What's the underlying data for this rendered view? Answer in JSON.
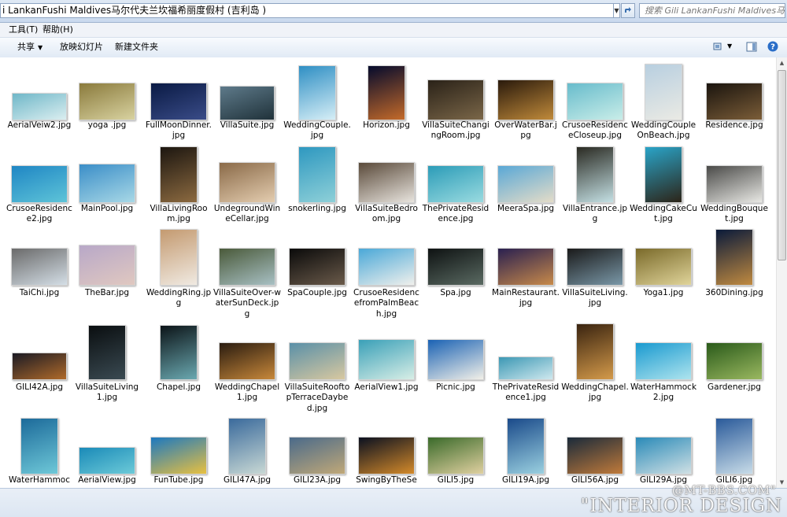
{
  "address_bar": {
    "path": "i LankanFushi Maldives马尔代夫兰坎福希丽度假村 (吉利岛 )",
    "search_placeholder": "搜索 Gili LankanFushi Maldives马..."
  },
  "menu": [
    "工具(T)",
    "帮助(H)"
  ],
  "toolbar": {
    "share": "共享",
    "slideshow": "放映幻灯片",
    "new_folder": "新建文件夹"
  },
  "files": [
    {
      "name": "AerialVeiw2.jpg",
      "c": [
        "#6fb7c8",
        "#dbeef0"
      ]
    },
    {
      "name": "yoga .jpg",
      "c": [
        "#8a7a3c",
        "#d8d2a0"
      ]
    },
    {
      "name": "FullMoonDinner.jpg",
      "c": [
        "#0a1a44",
        "#3a4c88"
      ]
    },
    {
      "name": "VillaSuite.jpg",
      "c": [
        "#5e7a8a",
        "#20323a"
      ]
    },
    {
      "name": "WeddingCouple.jpg",
      "c": [
        "#2f8fc4",
        "#d6eef6"
      ]
    },
    {
      "name": "Horizon.jpg",
      "c": [
        "#040a2c",
        "#c46a2a"
      ]
    },
    {
      "name": "VillaSuiteChangingRoom.jpg",
      "c": [
        "#2a2218",
        "#7a6648"
      ]
    },
    {
      "name": "OverWaterBar.jpg",
      "c": [
        "#2a1a0c",
        "#c08a3a"
      ]
    },
    {
      "name": "CrusoeResidenceCloseup.jpg",
      "c": [
        "#68bccc",
        "#c9ede8"
      ]
    },
    {
      "name": "WeddingCoupleOnBeach.jpg",
      "c": [
        "#b8cfe0",
        "#eaeae4"
      ]
    },
    {
      "name": "Residence.jpg",
      "c": [
        "#1a140e",
        "#7b5d38"
      ]
    },
    {
      "name": "CrusoeResidence2.jpg",
      "c": [
        "#1f86c4",
        "#5ec4d8"
      ]
    },
    {
      "name": "MainPool.jpg",
      "c": [
        "#3b8ec8",
        "#a8d8e6"
      ]
    },
    {
      "name": "VillaLivingRoom.jpg",
      "c": [
        "#1c1610",
        "#8c6a40"
      ]
    },
    {
      "name": "UndegroundWineCellar.jpg",
      "c": [
        "#8a6a48",
        "#e4cdb0"
      ]
    },
    {
      "name": "snokerling.jpg",
      "c": [
        "#2e98c0",
        "#8ed0d8"
      ]
    },
    {
      "name": "VillaSuiteBedroom.jpg",
      "c": [
        "#5a4a3a",
        "#e8e4de"
      ]
    },
    {
      "name": "ThePrivateResidence.jpg",
      "c": [
        "#2c9cb8",
        "#9adbe0"
      ]
    },
    {
      "name": "MeeraSpa.jpg",
      "c": [
        "#5aa8d6",
        "#e4dcc8"
      ]
    },
    {
      "name": "VillaEntrance.jpg",
      "c": [
        "#2a2a22",
        "#c4e0e4"
      ]
    },
    {
      "name": "WeddingCakeCut.jpg",
      "c": [
        "#2aa4c8",
        "#2c2418"
      ]
    },
    {
      "name": "WeddingBouquet.jpg",
      "c": [
        "#4a4a48",
        "#e8e8e4"
      ]
    },
    {
      "name": "TaiChi.jpg",
      "c": [
        "#6a6a6a",
        "#d4dee6"
      ]
    },
    {
      "name": "TheBar.jpg",
      "c": [
        "#b8a8c8",
        "#e0c8c0"
      ]
    },
    {
      "name": "WeddingRing.jpg",
      "c": [
        "#c49a70",
        "#f0eae2"
      ]
    },
    {
      "name": "VillaSuiteOver-waterSunDeck.jpg",
      "c": [
        "#4a5a3a",
        "#a8c0c4"
      ]
    },
    {
      "name": "SpaCouple.jpg",
      "c": [
        "#0a0a0a",
        "#6a5a4a"
      ]
    },
    {
      "name": "CrusoeResidencefromPalmBeach.jpg",
      "c": [
        "#4aa8d8",
        "#f0f0ec"
      ]
    },
    {
      "name": "Spa.jpg",
      "c": [
        "#0e1212",
        "#5a6a62"
      ]
    },
    {
      "name": "MainRestaurant.jpg",
      "c": [
        "#2a2050",
        "#c88a4a"
      ]
    },
    {
      "name": "VillaSuiteLiving.jpg",
      "c": [
        "#1a1a1a",
        "#7a98a8"
      ]
    },
    {
      "name": "Yoga1.jpg",
      "c": [
        "#7a6a2a",
        "#e0d49a"
      ]
    },
    {
      "name": "360Dining.jpg",
      "c": [
        "#0a1a3a",
        "#c08a40"
      ]
    },
    {
      "name": "GILI42A.jpg",
      "c": [
        "#1a1a24",
        "#b06a2a"
      ]
    },
    {
      "name": "VillaSuiteLiving1.jpg",
      "c": [
        "#0a0e10",
        "#3a4a52"
      ]
    },
    {
      "name": "Chapel.jpg",
      "c": [
        "#0c1418",
        "#6aa8b0"
      ]
    },
    {
      "name": "WeddingChapel1.jpg",
      "c": [
        "#2a1c10",
        "#c8883a"
      ]
    },
    {
      "name": "VillaSuiteRooftopTerraceDaybed.jpg",
      "c": [
        "#5a90a8",
        "#d8c8a0"
      ]
    },
    {
      "name": "AerialView1.jpg",
      "c": [
        "#3aa0b8",
        "#d8eee6"
      ]
    },
    {
      "name": "Picnic.jpg",
      "c": [
        "#1a62b4",
        "#f2f0e8"
      ]
    },
    {
      "name": "ThePrivateResidence1.jpg",
      "c": [
        "#3c98b4",
        "#cfe8ee"
      ]
    },
    {
      "name": "WeddingChapel.jpg",
      "c": [
        "#3a2410",
        "#d49a4a"
      ]
    },
    {
      "name": "WaterHammock2.jpg",
      "c": [
        "#1a9ad0",
        "#aee4ee"
      ]
    },
    {
      "name": "Gardener.jpg",
      "c": [
        "#2a5a1a",
        "#9ab860"
      ]
    },
    {
      "name": "WaterHammoc",
      "c": [
        "#1c6a9a",
        "#6ec8d8"
      ]
    },
    {
      "name": "AerialView.jpg",
      "c": [
        "#1a8ab8",
        "#6ccad8"
      ]
    },
    {
      "name": "FunTube.jpg",
      "c": [
        "#1c78c0",
        "#e8c040"
      ]
    },
    {
      "name": "GILI47A.jpg",
      "c": [
        "#3a6a9c",
        "#c8d8d4"
      ]
    },
    {
      "name": "GILI23A.jpg",
      "c": [
        "#4a6a8a",
        "#c0a878"
      ]
    },
    {
      "name": "SwingByTheSea.",
      "c": [
        "#0a1020",
        "#d48a2a"
      ]
    },
    {
      "name": "GILI5.jpg",
      "c": [
        "#3a6a2a",
        "#e0d0a0"
      ]
    },
    {
      "name": "GILI19A.jpg",
      "c": [
        "#1a4a8a",
        "#9ad0e0"
      ]
    },
    {
      "name": "GILI56A.jpg",
      "c": [
        "#1a2a3a",
        "#c07a3a"
      ]
    },
    {
      "name": "GILI29A.jpg",
      "c": [
        "#2a8ab8",
        "#d0e0e4"
      ]
    },
    {
      "name": "GILI6.jpg",
      "c": [
        "#2a5a9a",
        "#c8dce8"
      ]
    }
  ],
  "watermark": {
    "line1": "@MT-BBS.COM\"",
    "line2": "\"INTERIOR DESIGN"
  }
}
